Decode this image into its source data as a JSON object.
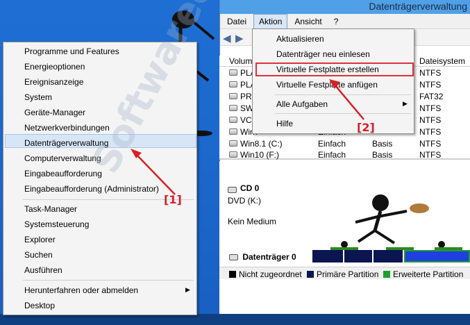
{
  "window": {
    "title": "Datenträgerverwaltung"
  },
  "menubar": {
    "items": [
      "Datei",
      "Aktion",
      "Ansicht",
      "?"
    ]
  },
  "volume_columns": {
    "layout": "Volume",
    "filesystem": "Dateisystem"
  },
  "volume_rows": [
    {
      "name": "PLA",
      "layout": "",
      "type": "",
      "fs": "NTFS"
    },
    {
      "name": "PLA",
      "layout": "",
      "type": "",
      "fs": "NTFS"
    },
    {
      "name": "PRO",
      "layout": "",
      "type": "",
      "fs": "FAT32"
    },
    {
      "name": "SWA",
      "layout": "",
      "type": "",
      "fs": "NTFS"
    },
    {
      "name": "VCP",
      "layout": "",
      "type": "",
      "fs": "NTFS"
    },
    {
      "name": "Win7",
      "layout": "Einfach",
      "type": "",
      "fs": "NTFS"
    },
    {
      "name": "Win8.1 (C:)",
      "layout": "Einfach",
      "type": "Basis",
      "fs": "NTFS"
    },
    {
      "name": "Win10 (F:)",
      "layout": "Einfach",
      "type": "Basis",
      "fs": "NTFS"
    }
  ],
  "cd_panel": {
    "name": "CD 0",
    "drive": "DVD (K:)",
    "media": "Kein Medium"
  },
  "disk0": {
    "name": "Datenträger 0"
  },
  "legend": {
    "unallocated": "Nicht zugeordnet",
    "primary": "Primäre Partition",
    "extended": "Erweiterte Partition"
  },
  "winx_menu": {
    "items": [
      "Programme und Features",
      "Energieoptionen",
      "Ereignisanzeige",
      "System",
      "Geräte-Manager",
      "Netzwerkverbindungen",
      "Datenträgerverwaltung",
      "Computerverwaltung",
      "Eingabeaufforderung",
      "Eingabeaufforderung (Administrator)",
      "Task-Manager",
      "Systemsteuerung",
      "Explorer",
      "Suchen",
      "Ausführen",
      "Herunterfahren oder abmelden",
      "Desktop"
    ],
    "highlighted": "Datenträgerverwaltung"
  },
  "aktion_menu": {
    "items": [
      "Aktualisieren",
      "Datenträger neu einlesen",
      "Virtuelle Festplatte erstellen",
      "Virtuelle Festplatte anfügen",
      "Alle Aufgaben",
      "Hilfe"
    ],
    "highlighted": "Virtuelle Festplatte erstellen"
  },
  "markers": {
    "m1": "[1]",
    "m2": "[2]"
  },
  "watermark": "Softwareok.de",
  "colors": {
    "desktop": "#1a5fc2",
    "highlight_border": "#e0303c",
    "marker": "#d81f26",
    "primary": "#0b1550",
    "extended": "#1f9f2f",
    "unallocated": "#000000"
  },
  "icons": [
    "back-arrow-icon",
    "forward-arrow-icon",
    "disk-icon",
    "cd-icon",
    "submenu-arrow-icon"
  ]
}
